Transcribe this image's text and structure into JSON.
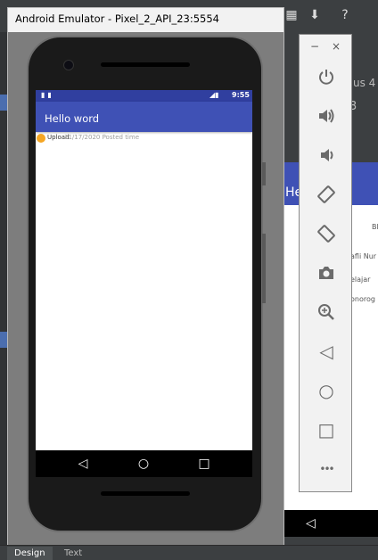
{
  "emulator": {
    "window_title": "Android Emulator - Pixel_2_API_23:5554",
    "status_time": "9:55",
    "app_title": "Hello word",
    "list_row_text": "Upload",
    "list_row_subtext": "11/17/2020 Posted time"
  },
  "toolbar": {
    "minimize": "−",
    "close": "×",
    "buttons": [
      {
        "name": "power-icon",
        "glyph": "⏻"
      },
      {
        "name": "volume-up-icon",
        "glyph": "🔊"
      },
      {
        "name": "volume-down-icon",
        "glyph": "🔉"
      },
      {
        "name": "rotate-left-icon",
        "glyph": "⟲"
      },
      {
        "name": "rotate-right-icon",
        "glyph": "⟳"
      },
      {
        "name": "camera-icon",
        "glyph": "📷"
      },
      {
        "name": "zoom-icon",
        "glyph": "🔍"
      },
      {
        "name": "back-icon",
        "glyph": "◁"
      },
      {
        "name": "home-icon",
        "glyph": "○"
      },
      {
        "name": "overview-icon",
        "glyph": "□"
      },
      {
        "name": "more-icon",
        "glyph": "•••"
      }
    ]
  },
  "navbar": {
    "back": "◁",
    "home": "○",
    "overview": "□"
  },
  "ide": {
    "device_partial": "us 4",
    "toolbar_number": "3",
    "preview_title": "He",
    "preview_lines": [
      "Bl",
      "afli Nur",
      "elajar",
      "onorog"
    ],
    "help_icon": "?",
    "tabs": [
      "Design",
      "Text"
    ]
  },
  "colors": {
    "primary": "#3f51b5",
    "primary_dark": "#303f9f",
    "accent": "#f5a623",
    "ide_bg": "#3c3f41"
  }
}
